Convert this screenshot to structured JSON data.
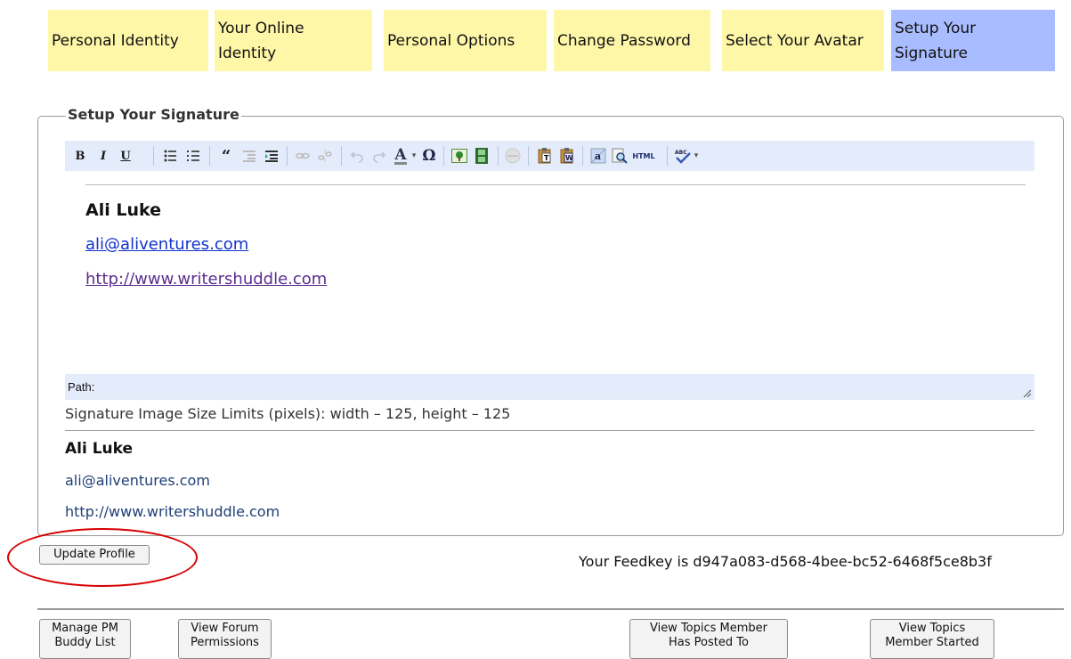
{
  "tabs": [
    {
      "label": "Personal Identity",
      "active": false
    },
    {
      "label": "Your Online Identity",
      "active": false
    },
    {
      "label": "Personal Options",
      "active": false
    },
    {
      "label": "Change Password",
      "active": false
    },
    {
      "label": "Select Your Avatar",
      "active": false
    },
    {
      "label": "Setup Your Signature",
      "active": true
    }
  ],
  "section": {
    "legend": "Setup Your Signature"
  },
  "toolbar": {
    "buttons": [
      "bold",
      "italic",
      "underline",
      "bullet-list",
      "numbered-list",
      "blockquote",
      "outdent",
      "indent",
      "link",
      "unlink",
      "undo",
      "redo",
      "font-color",
      "special-character",
      "insert-image",
      "insert-media",
      "emoticon",
      "paste-text",
      "paste-word",
      "spell-replace",
      "find",
      "html-source",
      "spellcheck"
    ],
    "labels": {
      "bold": "B",
      "italic": "I",
      "underline": "U",
      "blockquote": "“",
      "font_color": "A",
      "omega": "Ω",
      "html": "HTML",
      "abc": "ABC"
    }
  },
  "editor": {
    "name": "Ali Luke",
    "email": "ali@aliventures.com",
    "url": "http://www.writershuddle.com",
    "path_label": "Path:"
  },
  "limits_text": "Signature Image Size Limits (pixels): width – 125, height – 125",
  "preview": {
    "name": "Ali Luke",
    "email": "ali@aliventures.com",
    "url": "http://www.writershuddle.com"
  },
  "update_button": "Update Profile",
  "feedkey_text": "Your Feedkey is d947a083-d568-4bee-bc52-6468f5ce8b3f",
  "bottom_buttons": [
    {
      "line1": "Manage PM",
      "line2": "Buddy List"
    },
    {
      "line1": "View Forum",
      "line2": "Permissions"
    },
    {
      "line1": "View Topics Member",
      "line2": "Has Posted To"
    },
    {
      "line1": "View Topics",
      "line2": "Member Started"
    }
  ],
  "colors": {
    "tab_inactive": "#fff7a8",
    "tab_active": "#a9bcff",
    "toolbar_bg": "#e4ecfb",
    "highlight_circle": "#d80000"
  }
}
